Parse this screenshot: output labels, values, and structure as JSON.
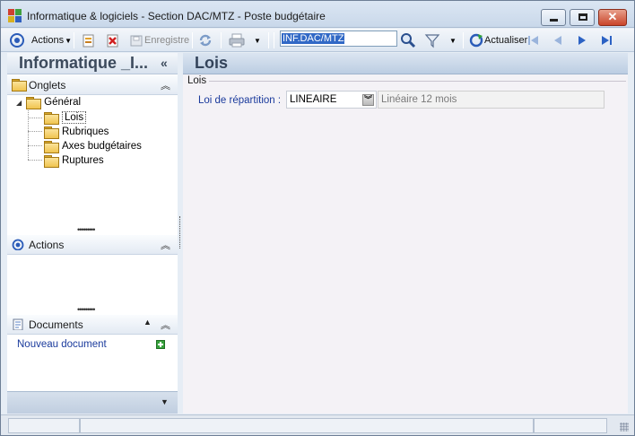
{
  "window": {
    "title": "Informatique & logiciels - Section DAC/MTZ -  Poste budgétaire",
    "minimize_glyph": "—",
    "maximize_glyph": "▢",
    "close_glyph": "✕"
  },
  "toolbar": {
    "actions_label": "Actions",
    "save_label": "Enregistre",
    "search_value": "INF.DAC/MTZ",
    "refresh_label": "Actualiser"
  },
  "left_pane": {
    "title": "Informatique _I...",
    "collapse_glyph": "«",
    "onglets": {
      "title": "Onglets",
      "tree": {
        "root": "Général",
        "children": [
          "Lois",
          "Rubriques",
          "Axes budgétaires",
          "Ruptures"
        ]
      }
    },
    "actions": {
      "title": "Actions"
    },
    "documents": {
      "title": "Documents",
      "new_document": "Nouveau document"
    }
  },
  "main": {
    "title": "Lois",
    "group": "Lois",
    "field_label": "Loi de répartition :",
    "field_value": "LINEAIRE",
    "field_description": "Linéaire 12 mois"
  },
  "colors": {
    "accent_blue": "#1a3a9c",
    "selection_blue": "#3169c6",
    "close_red": "#c9452a"
  }
}
